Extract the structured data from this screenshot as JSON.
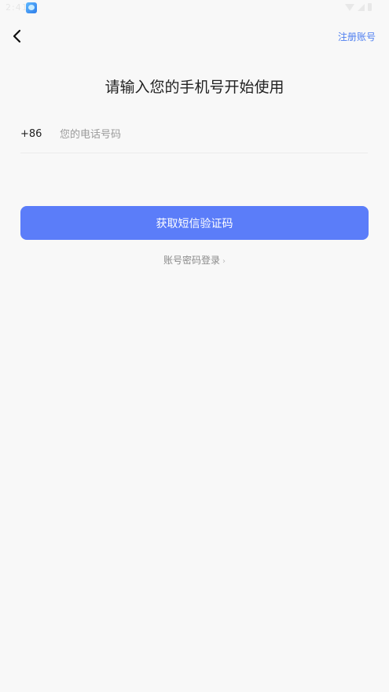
{
  "status_bar": {
    "time": "2:41",
    "app_icon": "app-notification-icon",
    "icons": [
      "wifi-icon",
      "signal-icon",
      "battery-icon"
    ]
  },
  "header": {
    "back_icon": "chevron-left-icon",
    "register_label": "注册账号"
  },
  "main": {
    "title": "请输入您的手机号开始使用",
    "country_code": "+86",
    "phone_placeholder": "您的电话号码",
    "phone_value": "",
    "sms_button_label": "获取短信验证码",
    "password_login_label": "账号密码登录",
    "password_login_chevron": "›"
  },
  "colors": {
    "background": "#f8f8f8",
    "accent": "#5b7df9",
    "link": "#4f7ff0",
    "muted_text": "#8a8a8a"
  }
}
